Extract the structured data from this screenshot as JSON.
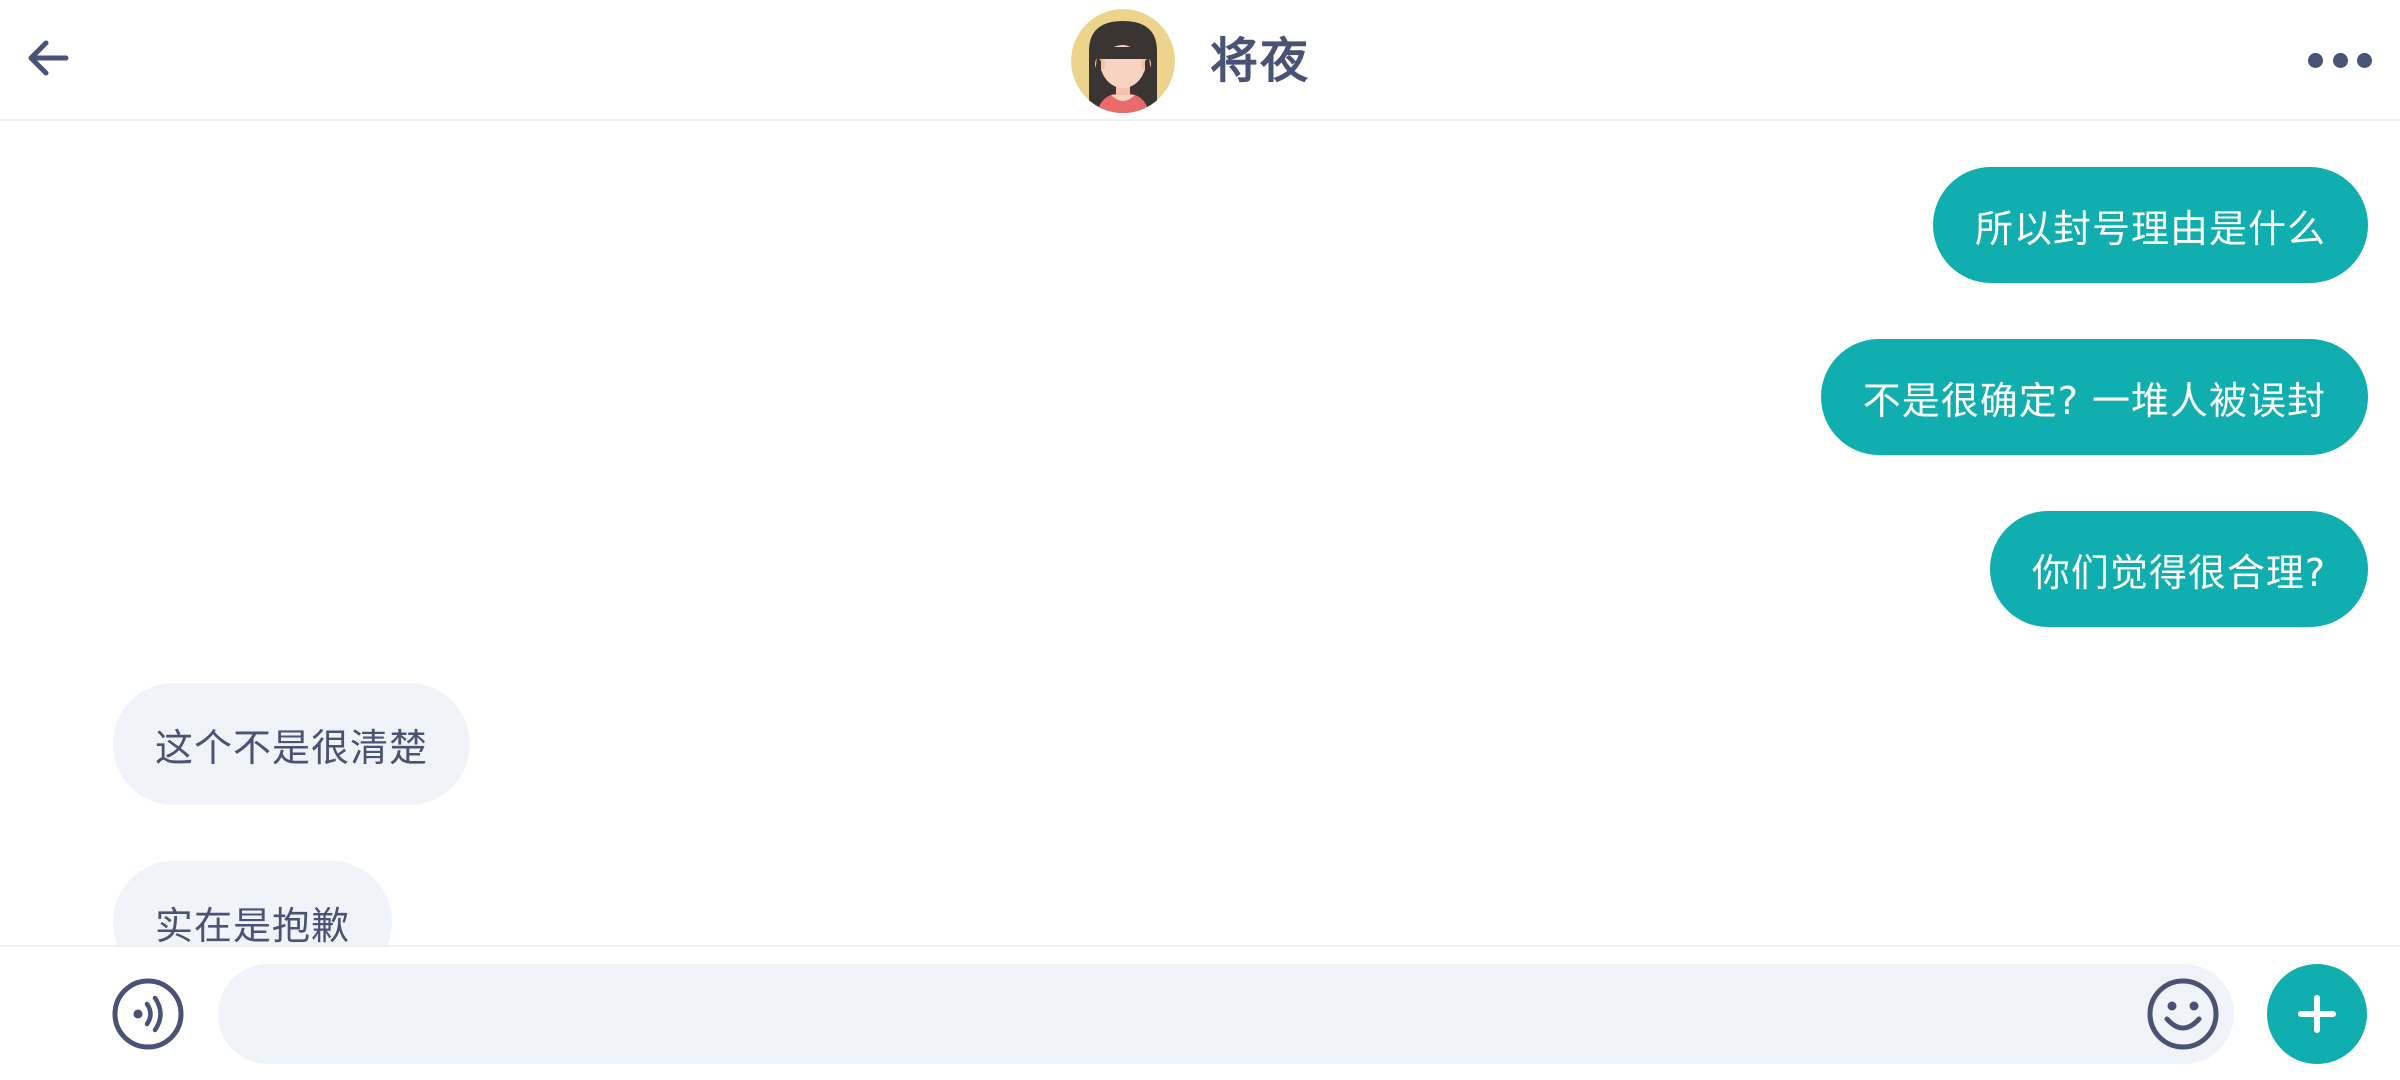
{
  "header": {
    "back_icon": "arrow-left-icon",
    "contact_name": "将夜",
    "avatar_icon": "girl-avatar-icon",
    "more_icon": "more-horizontal-icon"
  },
  "messages": [
    {
      "direction": "outgoing",
      "text": "所以封号理由是什么"
    },
    {
      "direction": "outgoing",
      "text": "不是很确定? 一堆人被误封"
    },
    {
      "direction": "outgoing",
      "text": "你们觉得很合理?"
    },
    {
      "direction": "incoming",
      "text": "这个不是很清楚"
    },
    {
      "direction": "incoming",
      "text": "实在是抱歉"
    }
  ],
  "input_bar": {
    "voice_icon": "voice-input-icon",
    "message_value": "",
    "placeholder": "",
    "emoji_icon": "smiley-icon",
    "plus_icon": "plus-icon"
  },
  "colors": {
    "accent": "#10aeae",
    "text_dark": "#4a5275",
    "incoming_bubble": "#f0f3f7",
    "avatar_bg": "#ecd48c"
  }
}
